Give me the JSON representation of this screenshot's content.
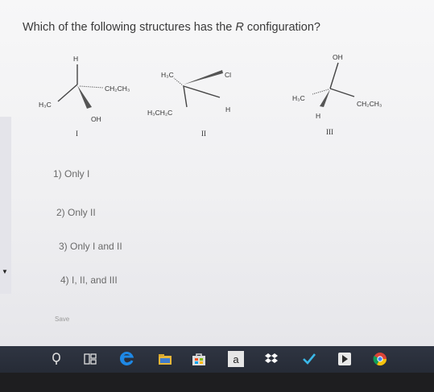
{
  "question": {
    "prefix": "Which of the following structures has the ",
    "config_letter": "R",
    "suffix": " configuration?"
  },
  "structures": [
    {
      "roman": "I",
      "labels": {
        "top": "H",
        "right": "CH₂CH₃",
        "left": "H₃C",
        "bottom": "OH"
      }
    },
    {
      "roman": "II",
      "labels": {
        "upper_left": "H₃C",
        "upper_right": "Cl",
        "right": "H",
        "lower_left": "H₃CH₂C"
      }
    },
    {
      "roman": "III",
      "labels": {
        "top": "OH",
        "left": "H₃C",
        "bottom": "H",
        "right": "CH₂CH₃"
      }
    }
  ],
  "choices": [
    "1) Only I",
    "2) Only II",
    "3) Only I and II",
    "4) I, II, and III"
  ],
  "save_label": "Save",
  "taskbar": {
    "icons": [
      "search-icon",
      "task-view-icon",
      "edge-icon",
      "file-explorer-icon",
      "store-icon",
      "amazon-icon",
      "dropbox-icon",
      "vpn-icon",
      "plex-icon",
      "chrome-icon"
    ],
    "amazon_label": "a"
  }
}
